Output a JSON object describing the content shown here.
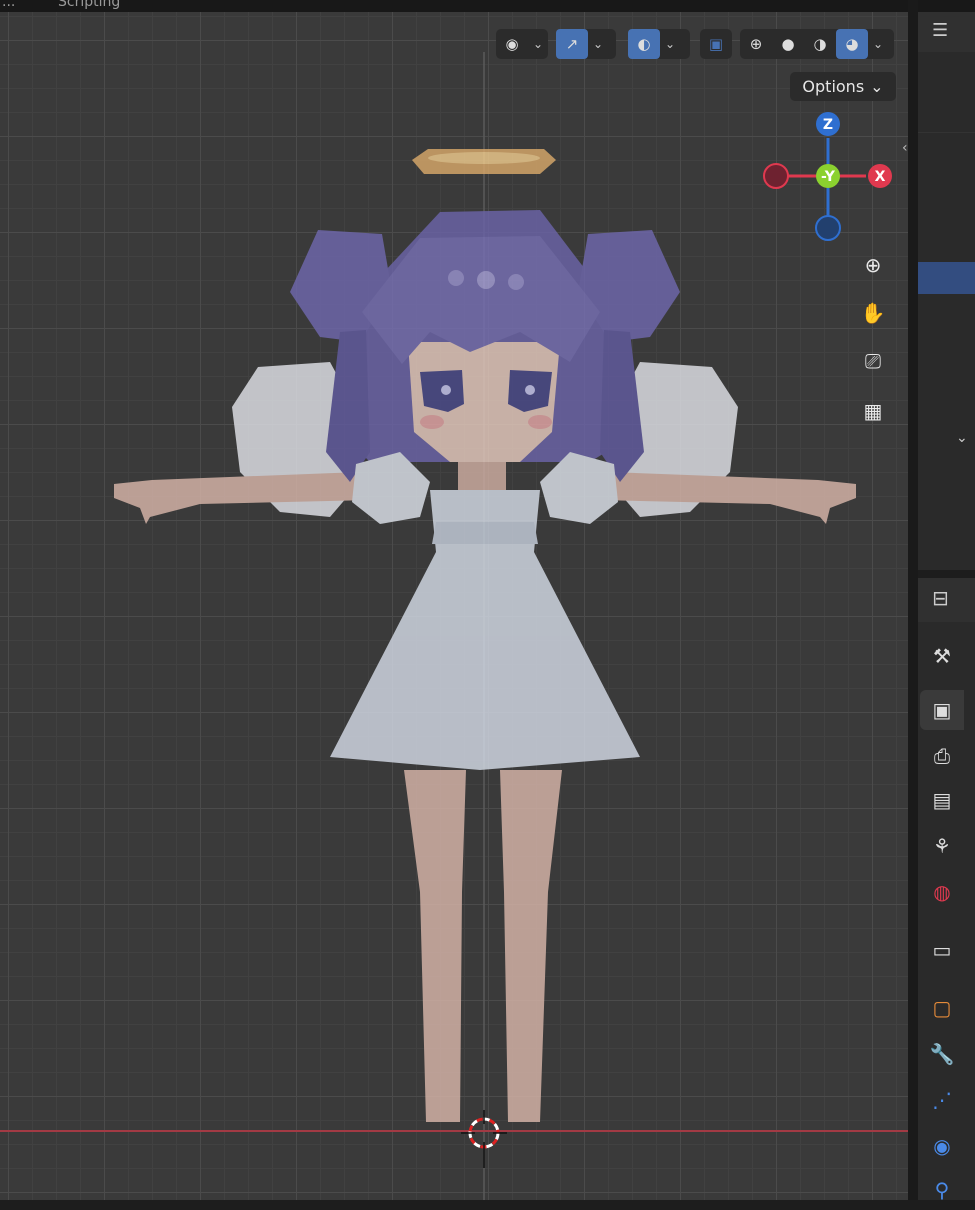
{
  "topbar": {
    "left_fragment": "...",
    "workspace_tab": "Scripting"
  },
  "header": {
    "visibility_icon": "selectability-visibility-icon",
    "gizmo_icon": "gizmo-toggle-icon",
    "overlay_icon": "overlays-icon",
    "xray_icon": "xray-icon",
    "shading_modes": [
      "wireframe",
      "solid",
      "material-preview",
      "rendered"
    ],
    "active_shading": "rendered",
    "options_label": "Options"
  },
  "gizmo": {
    "z": "Z",
    "neg_y": "-Y",
    "x": "X"
  },
  "nav_tools": [
    "zoom-icon",
    "hand-pan-icon",
    "camera-view-icon",
    "grid-ortho-icon"
  ],
  "properties_tabs": [
    "tool",
    "render",
    "output",
    "view-layer",
    "scene",
    "world",
    "collection",
    "object",
    "modifiers",
    "particles",
    "physics",
    "constraints"
  ],
  "active_properties_tab": "render",
  "colors": {
    "x_axis": "#e0394f",
    "y_axis": "#8bd12f",
    "z_axis": "#2f6fd0",
    "accent": "#4772b3"
  }
}
